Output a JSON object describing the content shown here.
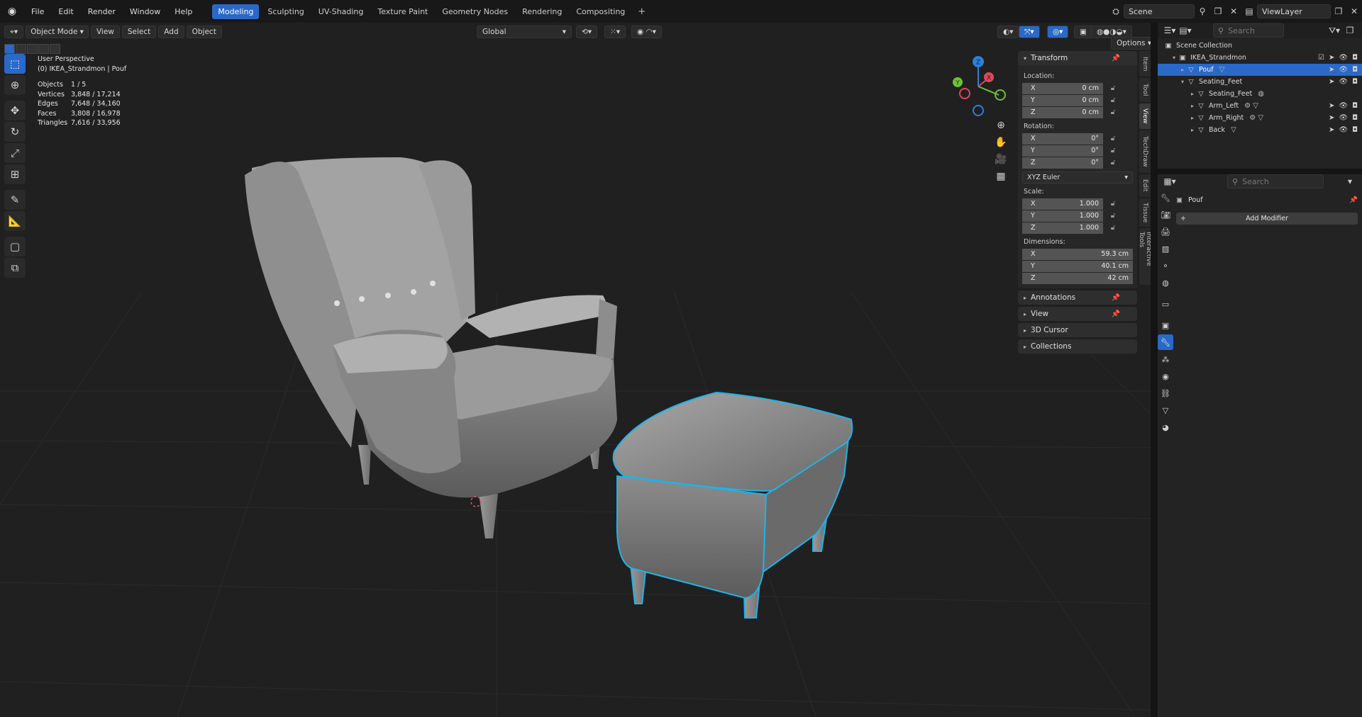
{
  "menu": [
    "File",
    "Edit",
    "Render",
    "Window",
    "Help"
  ],
  "workspaces": [
    {
      "label": "Modeling",
      "active": true
    },
    {
      "label": "Sculpting"
    },
    {
      "label": "UV-Shading"
    },
    {
      "label": "Texture Paint"
    },
    {
      "label": "Geometry Nodes"
    },
    {
      "label": "Rendering"
    },
    {
      "label": "Compositing"
    }
  ],
  "scene": {
    "name": "Scene",
    "view_layer": "ViewLayer",
    "search_placeholder": "Search"
  },
  "viewport_header": {
    "mode": "Object Mode",
    "menus": [
      "View",
      "Select",
      "Add",
      "Object"
    ],
    "orientation": "Global",
    "options": "Options"
  },
  "stats": {
    "perspective": "User Perspective",
    "collection": "(0) IKEA_Strandmon | Pouf",
    "rows": [
      {
        "k": "Objects",
        "v": "1 / 5"
      },
      {
        "k": "Vertices",
        "v": "3,848 / 17,214"
      },
      {
        "k": "Edges",
        "v": "7,648 / 34,160"
      },
      {
        "k": "Faces",
        "v": "3,808 / 16,978"
      },
      {
        "k": "Triangles",
        "v": "7,616 / 33,956"
      }
    ]
  },
  "gizmo": {
    "axes": [
      "Z",
      "Y",
      "X"
    ]
  },
  "transform": {
    "title": "Transform",
    "location_label": "Location:",
    "location": [
      {
        "axis": "X",
        "value": "0 cm"
      },
      {
        "axis": "Y",
        "value": "0 cm"
      },
      {
        "axis": "Z",
        "value": "0 cm"
      }
    ],
    "rotation_label": "Rotation:",
    "rotation": [
      {
        "axis": "X",
        "value": "0°"
      },
      {
        "axis": "Y",
        "value": "0°"
      },
      {
        "axis": "Z",
        "value": "0°"
      }
    ],
    "rotation_mode": "XYZ Euler",
    "scale_label": "Scale:",
    "scale": [
      {
        "axis": "X",
        "value": "1.000"
      },
      {
        "axis": "Y",
        "value": "1.000"
      },
      {
        "axis": "Z",
        "value": "1.000"
      }
    ],
    "dimensions_label": "Dimensions:",
    "dimensions": [
      {
        "axis": "X",
        "value": "59.3 cm"
      },
      {
        "axis": "Y",
        "value": "40.1 cm"
      },
      {
        "axis": "Z",
        "value": "42 cm"
      }
    ]
  },
  "panels": [
    "Annotations",
    "View",
    "3D Cursor",
    "Collections"
  ],
  "vtabs": [
    "Item",
    "Tool",
    "View",
    "TechDraw",
    "Edit",
    "Tissue",
    "Interactive Tools"
  ],
  "outliner": {
    "root": "Scene Collection",
    "items": [
      {
        "name": "IKEA_Strandmon",
        "depth": 1
      },
      {
        "name": "Pouf",
        "depth": 2,
        "selected": true
      },
      {
        "name": "Seating_Feet",
        "depth": 2
      },
      {
        "name": "Seating_Feet",
        "depth": 3
      },
      {
        "name": "Arm_Left",
        "depth": 3
      },
      {
        "name": "Arm_Right",
        "depth": 3
      },
      {
        "name": "Back",
        "depth": 3
      }
    ]
  },
  "properties": {
    "search_placeholder": "Search",
    "object_name": "Pouf",
    "add_modifier": "Add Modifier"
  },
  "colors": {
    "accent": "#2a69c7",
    "selection_outline": "#1fb3e8",
    "background": "#1d1d1d"
  }
}
